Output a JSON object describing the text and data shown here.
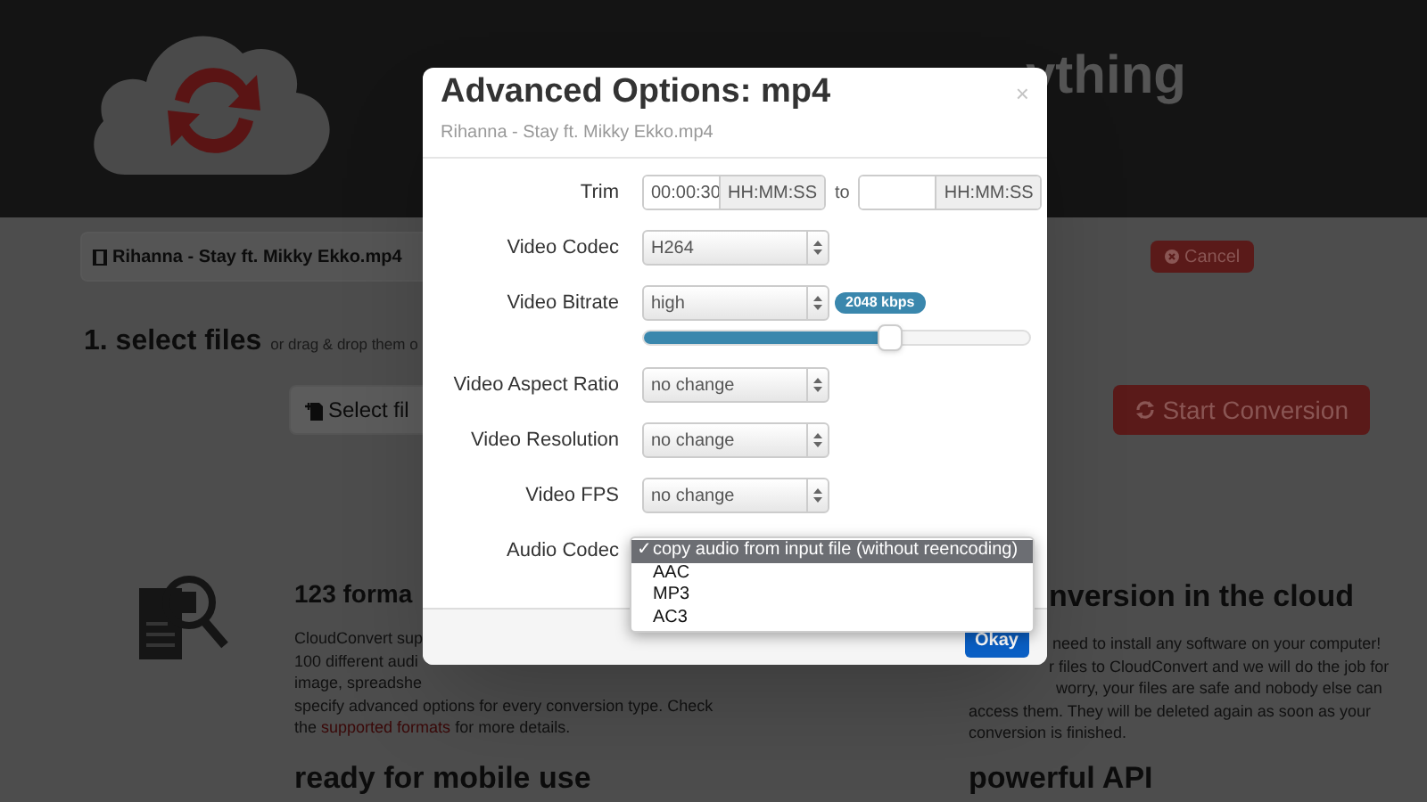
{
  "header": {
    "title": "ything"
  },
  "file": {
    "name": "Rihanna - Stay ft. Mikky Ekko.mp4",
    "cancel": "Cancel"
  },
  "step": {
    "title": "1. select files",
    "hint": "or drag & drop them o"
  },
  "actions": {
    "select_files": "Select fil",
    "start": "Start Conversion"
  },
  "features": [
    {
      "title": "123 forma",
      "lines": [
        "CloudConvert sup",
        "100 different audi",
        "image, spreadshe",
        "specify advanced options for every conversion type. Check"
      ],
      "link_line": {
        "before": "the ",
        "link": "supported formats",
        "after": " for more details."
      }
    },
    {
      "title": "nversion in the cloud",
      "lines": [
        "need to install any software on your computer!",
        "r files to CloudConvert and we will do the job for",
        "worry, your files are safe and nobody else can",
        "access them. They will be deleted again as soon as your",
        "conversion is finished."
      ]
    }
  ],
  "more_features": [
    "ready for mobile use",
    "powerful API"
  ],
  "dialog": {
    "title": "Advanced Options: mp4",
    "subtitle": "Rihanna - Stay ft. Mikky Ekko.mp4",
    "close": "×",
    "fields": [
      {
        "kind": "range",
        "label": "Trim",
        "start": {
          "value": "00:00:30",
          "addon": "HH:MM:SS"
        },
        "separator": "to",
        "end": {
          "addon": "HH:MM:SS"
        }
      },
      {
        "kind": "select",
        "label": "Video Codec",
        "value": "H264"
      },
      {
        "kind": "select",
        "label": "Video Bitrate",
        "value": "high",
        "badge": "2048 kbps",
        "level": 0.64
      },
      {
        "kind": "select",
        "label": "Video Aspect Ratio",
        "value": "no change"
      },
      {
        "kind": "select",
        "label": "Video Resolution",
        "value": "no change"
      },
      {
        "kind": "select",
        "label": "Video FPS",
        "value": "no change"
      },
      {
        "kind": "dropdown",
        "label": "Audio Codec",
        "check_mark": "✓",
        "options": [
          {
            "label": "copy audio from input file (without reencoding)",
            "selected": true
          },
          {
            "label": "AAC",
            "selected": false
          },
          {
            "label": "MP3",
            "selected": false
          },
          {
            "label": "AC3",
            "selected": false
          }
        ]
      }
    ],
    "ok": "Okay"
  }
}
